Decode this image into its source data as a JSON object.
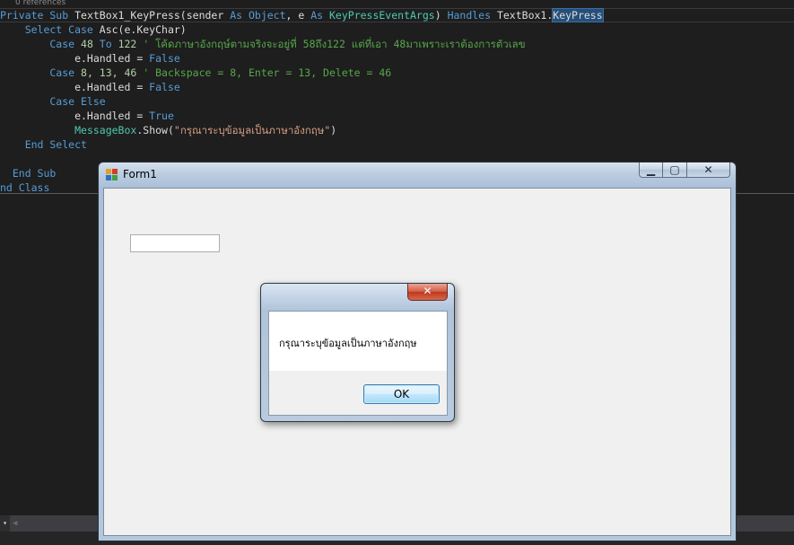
{
  "editor": {
    "references": "0 references",
    "lines": [
      [
        {
          "t": "Private Sub ",
          "c": "kw"
        },
        {
          "t": "TextBox1_KeyPress(sender ",
          "c": ""
        },
        {
          "t": "As ",
          "c": "kw"
        },
        {
          "t": "Object",
          "c": "kw"
        },
        {
          "t": ", e ",
          "c": ""
        },
        {
          "t": "As ",
          "c": "kw"
        },
        {
          "t": "KeyPressEventArgs",
          "c": "ty"
        },
        {
          "t": ") ",
          "c": ""
        },
        {
          "t": "Handles ",
          "c": "kw"
        },
        {
          "t": "TextBox1.",
          "c": ""
        },
        {
          "t": "KeyPress",
          "c": "sel"
        }
      ],
      [
        {
          "t": "    Select Case ",
          "c": "kw"
        },
        {
          "t": "Asc(e.KeyChar)",
          "c": ""
        }
      ],
      [
        {
          "t": "        Case ",
          "c": "kw"
        },
        {
          "t": "48 ",
          "c": "num"
        },
        {
          "t": "To ",
          "c": "kw"
        },
        {
          "t": "122 ",
          "c": "num"
        },
        {
          "t": "' โค้ดภาษาอังกฤษ์ตามจริงจะอยู่ที่ 58ถึง122 แต่ที่เอา 48มาเพราะเราต้องการตัวเลข",
          "c": "cm"
        }
      ],
      [
        {
          "t": "            e.Handled = ",
          "c": ""
        },
        {
          "t": "False",
          "c": "kw"
        }
      ],
      [
        {
          "t": "        Case ",
          "c": "kw"
        },
        {
          "t": "8, 13, 46 ",
          "c": "num"
        },
        {
          "t": "' Backspace = 8, Enter = 13, Delete = 46",
          "c": "cm"
        }
      ],
      [
        {
          "t": "            e.Handled = ",
          "c": ""
        },
        {
          "t": "False",
          "c": "kw"
        }
      ],
      [
        {
          "t": "        Case Else",
          "c": "kw"
        }
      ],
      [
        {
          "t": "            e.Handled = ",
          "c": ""
        },
        {
          "t": "True",
          "c": "kw"
        }
      ],
      [
        {
          "t": "            ",
          "c": ""
        },
        {
          "t": "MessageBox",
          "c": "ty"
        },
        {
          "t": ".Show(",
          "c": ""
        },
        {
          "t": "\"กรุณาระบุข้อมูลเป็นภาษาอังกฤษ\"",
          "c": "str"
        },
        {
          "t": ")",
          "c": ""
        }
      ],
      [
        {
          "t": "    End Select",
          "c": "kw"
        }
      ],
      [
        {
          "t": "",
          "c": ""
        }
      ],
      [
        {
          "t": "  End Sub",
          "c": "kw"
        }
      ],
      [
        {
          "t": "nd Class",
          "c": "kw"
        }
      ]
    ]
  },
  "form": {
    "title": "Form1",
    "icon_name": "form-app-icon",
    "minimize_icon": "minimize-icon",
    "maximize_icon": "maximize-icon",
    "close_icon": "close-icon",
    "minimize_glyph": "▁",
    "maximize_glyph": "▢",
    "close_glyph": "✕",
    "textbox_value": ""
  },
  "messagebox": {
    "close_glyph": "✕",
    "text": "กรุณาระบุข้อมูลเป็นภาษาอังกฤษ",
    "ok_label": "OK"
  },
  "colors": {
    "editor_bg": "#1e1e1e",
    "keyword": "#569cd6",
    "type": "#4ec9b0",
    "number": "#b5cea8",
    "comment": "#57a64a",
    "string": "#d69d85",
    "selection": "#264f78",
    "close_button": "#c0371c"
  }
}
